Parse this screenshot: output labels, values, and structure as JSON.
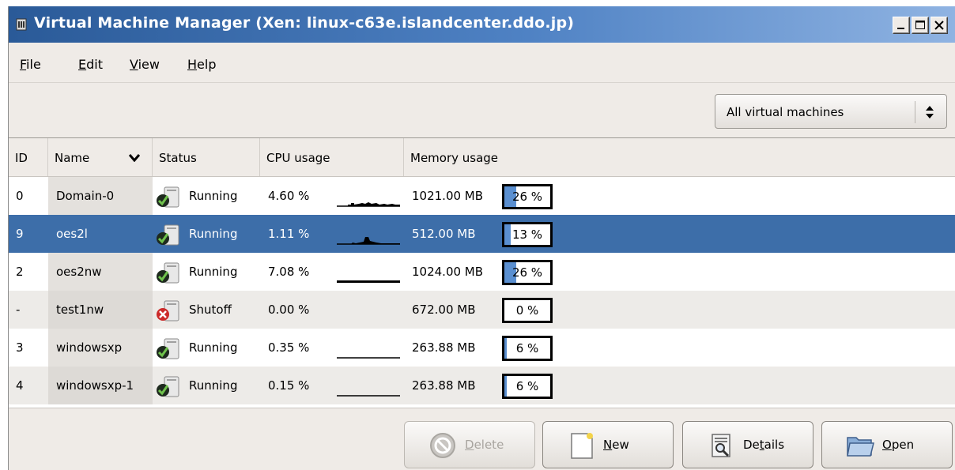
{
  "window": {
    "title": "Virtual Machine Manager (Xen: linux-c63e.islandcenter.ddo.jp)"
  },
  "menu": [
    {
      "label": "File",
      "mnemonic": "F",
      "rest": "ile"
    },
    {
      "label": "Edit",
      "mnemonic": "E",
      "rest": "dit"
    },
    {
      "label": "View",
      "mnemonic": "V",
      "rest": "iew"
    },
    {
      "label": "Help",
      "mnemonic": "H",
      "rest": "elp"
    }
  ],
  "filter": {
    "selected": "All virtual machines"
  },
  "columns": {
    "id": "ID",
    "name": "Name",
    "status": "Status",
    "cpu": "CPU usage",
    "memory": "Memory usage"
  },
  "rows": [
    {
      "id": "0",
      "name": "Domain-0",
      "status": "Running",
      "cpu": "4.60 %",
      "memory": "1021.00 MB",
      "mem_pct": "26 %",
      "mem_fraction": 0.26
    },
    {
      "id": "9",
      "name": "oes2l",
      "status": "Running",
      "cpu": "1.11 %",
      "memory": "512.00 MB",
      "mem_pct": "13 %",
      "mem_fraction": 0.13
    },
    {
      "id": "2",
      "name": "oes2nw",
      "status": "Running",
      "cpu": "7.08 %",
      "memory": "1024.00 MB",
      "mem_pct": "26 %",
      "mem_fraction": 0.26
    },
    {
      "id": "-",
      "name": "test1nw",
      "status": "Shutoff",
      "cpu": "0.00 %",
      "memory": "672.00 MB",
      "mem_pct": "0 %",
      "mem_fraction": 0
    },
    {
      "id": "3",
      "name": "windowsxp",
      "status": "Running",
      "cpu": "0.35 %",
      "memory": "263.88 MB",
      "mem_pct": "6 %",
      "mem_fraction": 0.06
    },
    {
      "id": "4",
      "name": "windowsxp-1",
      "status": "Running",
      "cpu": "0.15 %",
      "memory": "263.88 MB",
      "mem_pct": "6 %",
      "mem_fraction": 0.06
    }
  ],
  "buttons": {
    "delete": {
      "mnemonic": "D",
      "rest": "elete",
      "enabled": false
    },
    "new": {
      "mnemonic": "N",
      "rest": "ew",
      "enabled": true
    },
    "details": {
      "pre": "De",
      "mnemonic": "t",
      "rest": "ails",
      "enabled": true
    },
    "open": {
      "mnemonic": "O",
      "rest": "pen",
      "enabled": true
    }
  },
  "colors": {
    "titlebar_start": "#2a5a98",
    "selection": "#3d6ea9",
    "memory_fill": "#5a8fd0"
  }
}
